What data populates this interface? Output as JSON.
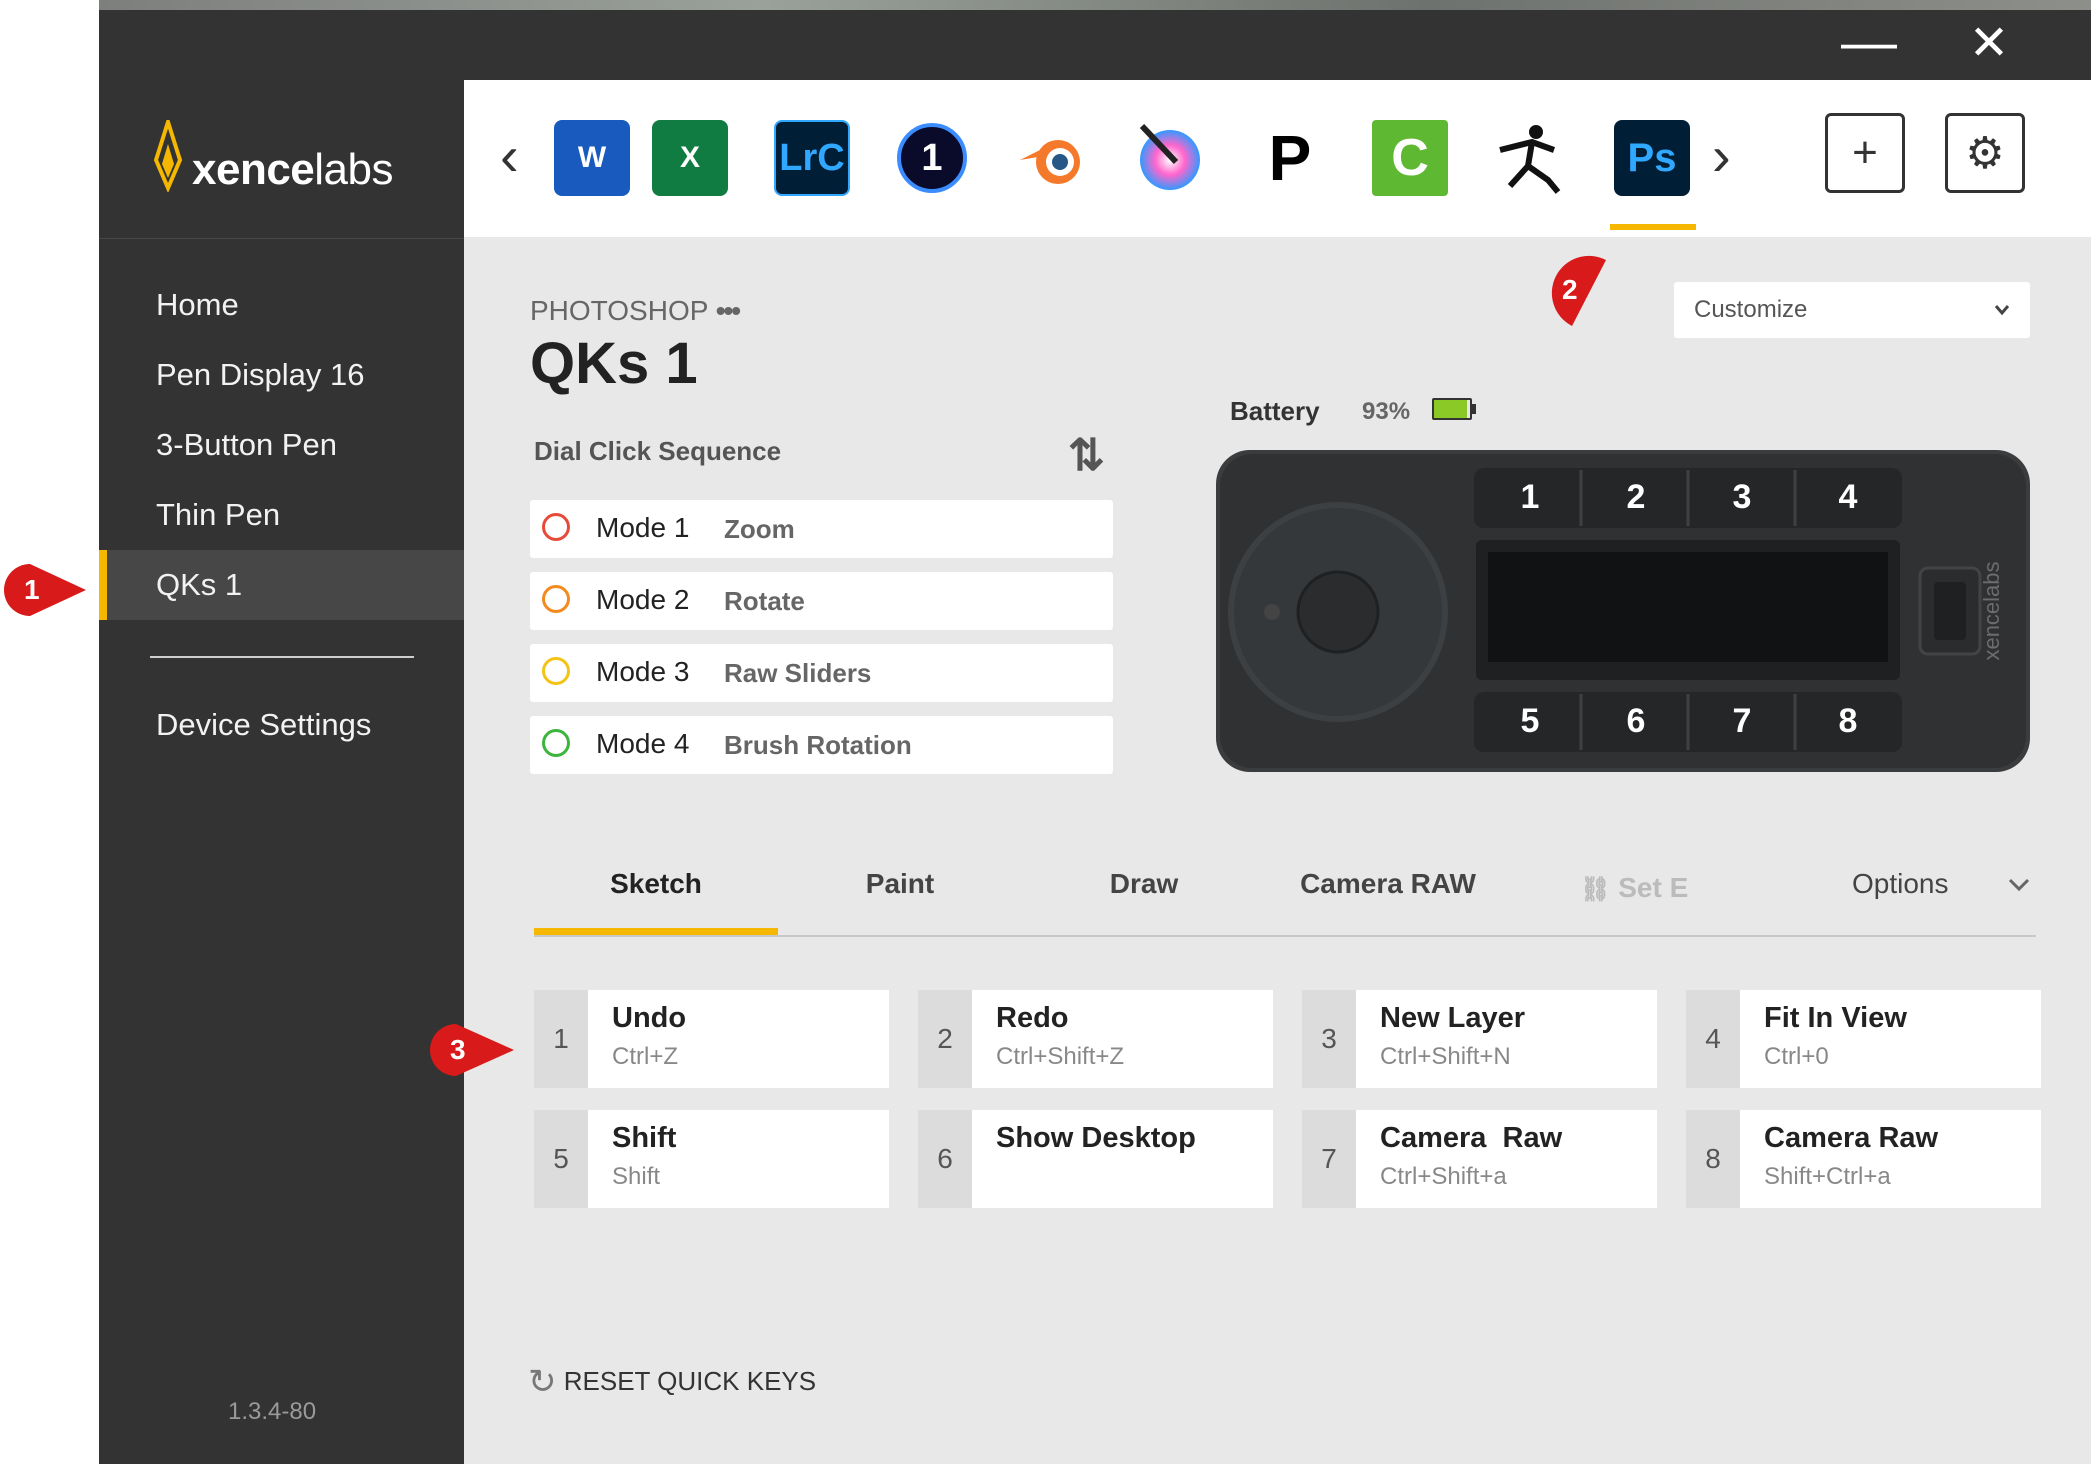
{
  "window": {
    "minimize_glyph": "—",
    "close_glyph": "✕"
  },
  "sidebar": {
    "logo_text_bold": "xence",
    "logo_text_light": "labs",
    "items": [
      {
        "label": "Home"
      },
      {
        "label": "Pen Display 16"
      },
      {
        "label": "3-Button Pen"
      },
      {
        "label": "Thin Pen"
      },
      {
        "label": "QKs 1",
        "active": true
      }
    ],
    "device_settings": "Device Settings",
    "version": "1.3.4-80"
  },
  "apps": {
    "prev_glyph": "‹",
    "next_glyph": "›",
    "list": [
      {
        "name": "word-icon",
        "label": "W",
        "color": "#185abd"
      },
      {
        "name": "excel-icon",
        "label": "X",
        "color": "#107c41"
      },
      {
        "name": "lightroom-classic-icon",
        "label": "LrC",
        "color": "#001e36"
      },
      {
        "name": "capture-one-icon",
        "label": "1",
        "color": "#0a0a2a"
      },
      {
        "name": "blender-icon",
        "label": "",
        "color": "#f5792a"
      },
      {
        "name": "krita-icon",
        "label": "",
        "color": "#e05cc0"
      },
      {
        "name": "pixelmator-icon",
        "label": "P",
        "color": "#000000"
      },
      {
        "name": "camtasia-icon",
        "label": "C",
        "color": "#5fb832"
      },
      {
        "name": "zbrush-icon",
        "label": "",
        "color": "#111111"
      },
      {
        "name": "photoshop-icon",
        "label": "Ps",
        "color": "#001e36",
        "active": true
      }
    ],
    "add_glyph": "+",
    "settings_glyph": "⚙",
    "active_color": "#f5b700"
  },
  "header": {
    "app_name": "PHOTOSHOP",
    "more_glyph": "•••",
    "device_title": "QKs 1",
    "customize_label": "Customize"
  },
  "dial": {
    "title": "Dial Click Sequence",
    "swap_glyph": "⇅",
    "modes": [
      {
        "name": "Mode 1",
        "function": "Zoom",
        "color": "#e84a3a"
      },
      {
        "name": "Mode 2",
        "function": "Rotate",
        "color": "#f28a1e"
      },
      {
        "name": "Mode 3",
        "function": "Raw Sliders",
        "color": "#f3c316"
      },
      {
        "name": "Mode 4",
        "function": "Brush Rotation",
        "color": "#3cb53c"
      }
    ]
  },
  "battery": {
    "label": "Battery",
    "value": "93%",
    "level": 0.93,
    "color": "#8ac926"
  },
  "device": {
    "brand": "xencelabs",
    "top_keys": [
      "1",
      "2",
      "3",
      "4"
    ],
    "bottom_keys": [
      "5",
      "6",
      "7",
      "8"
    ]
  },
  "tabs": {
    "items": [
      "Sketch",
      "Paint",
      "Draw",
      "Camera RAW"
    ],
    "active": "Sketch",
    "disabled_label": "Set E",
    "options_label": "Options",
    "chevron_glyph": "⌄"
  },
  "keys": [
    {
      "num": "1",
      "name": "Undo",
      "shortcut": "Ctrl+Z"
    },
    {
      "num": "2",
      "name": "Redo",
      "shortcut": "Ctrl+Shift+Z"
    },
    {
      "num": "3",
      "name": "New Layer",
      "shortcut": "Ctrl+Shift+N"
    },
    {
      "num": "4",
      "name": "Fit In View",
      "shortcut": "Ctrl+0"
    },
    {
      "num": "5",
      "name": "Shift",
      "shortcut": "Shift"
    },
    {
      "num": "6",
      "name": "Show Desktop",
      "shortcut": ""
    },
    {
      "num": "7",
      "name": "Camera  Raw",
      "shortcut": "Ctrl+Shift+a"
    },
    {
      "num": "8",
      "name": "Camera Raw",
      "shortcut": "Shift+Ctrl+a"
    }
  ],
  "reset": {
    "glyph": "↻",
    "label": "RESET QUICK KEYS"
  },
  "annotations": {
    "color": "#d91a1a",
    "markers": [
      "1",
      "2",
      "3"
    ]
  }
}
